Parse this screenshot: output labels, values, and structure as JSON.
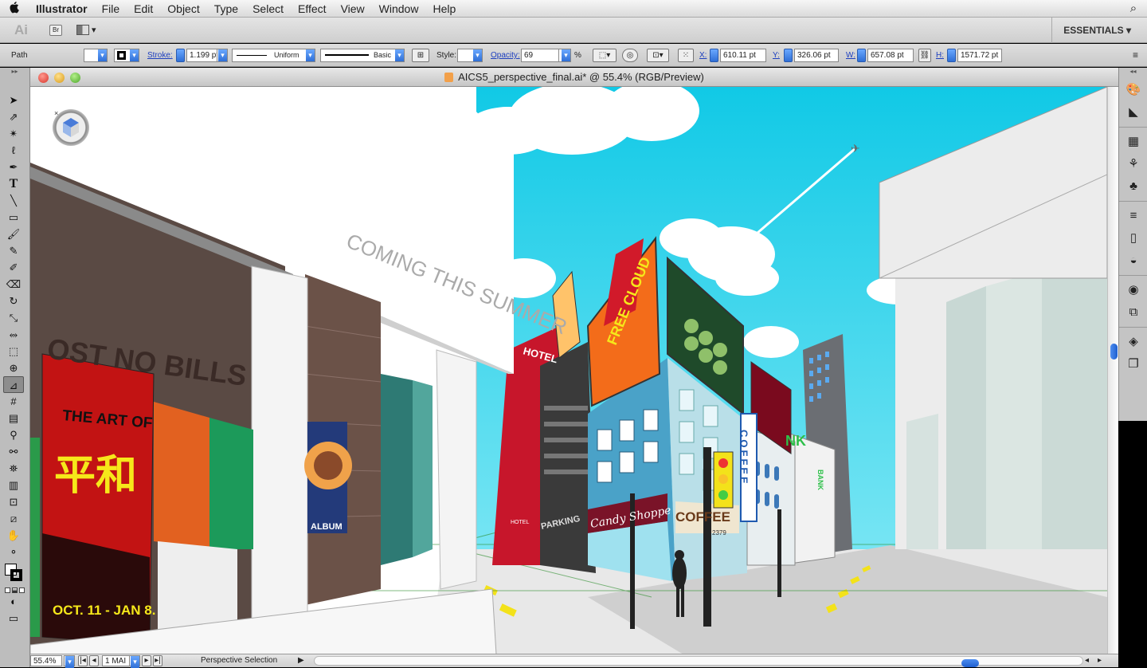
{
  "menubar": {
    "apple": "",
    "app_name": "Illustrator",
    "items": [
      "File",
      "Edit",
      "Object",
      "Type",
      "Select",
      "Effect",
      "View",
      "Window",
      "Help"
    ],
    "spotlight": "⌕"
  },
  "appbar": {
    "logo": "Ai",
    "bridge": "Br",
    "workspace": "ESSENTIALS ▾"
  },
  "control": {
    "selection_type": "Path",
    "stroke_label": "Stroke:",
    "stroke_weight": "1.199 pt",
    "variable_width": "Uniform",
    "brush": "Basic",
    "style_label": "Style:",
    "opacity_label": "Opacity:",
    "opacity_value": "69",
    "percent": "%",
    "x_label": "X:",
    "x_value": "610.11 pt",
    "y_label": "Y:",
    "y_value": "326.06 pt",
    "w_label": "W:",
    "w_value": "657.08 pt",
    "h_label": "H:",
    "h_value": "1571.72 pt"
  },
  "document": {
    "title": "AICS5_perspective_final.ai* @ 55.4% (RGB/Preview)"
  },
  "artwork": {
    "wall_text": "COMING THIS SUMMER",
    "post_text": "OST NO BILLS",
    "poster_title": "THE ART OF",
    "poster_glyphs": "平和",
    "poster_dates": "OCT. 11 - JAN 8.",
    "album": "ALBUM",
    "billboard": "FREE CLOUD",
    "hotel": "HOTEL",
    "hotel_small": "HOTEL",
    "parking": "PARKING",
    "candy": "Candy Shoppe",
    "coffee_vertical": "COFFEE",
    "coffee_front": "COFFEE",
    "bank": "NK",
    "bank_side": "BANK",
    "number": "2379"
  },
  "status": {
    "zoom": "55.4%",
    "artboard": "1 MAI",
    "tool": "Perspective Selection"
  },
  "colors": {
    "sky": "#1fd6ee",
    "accent_blue": "#2f6fd6"
  }
}
